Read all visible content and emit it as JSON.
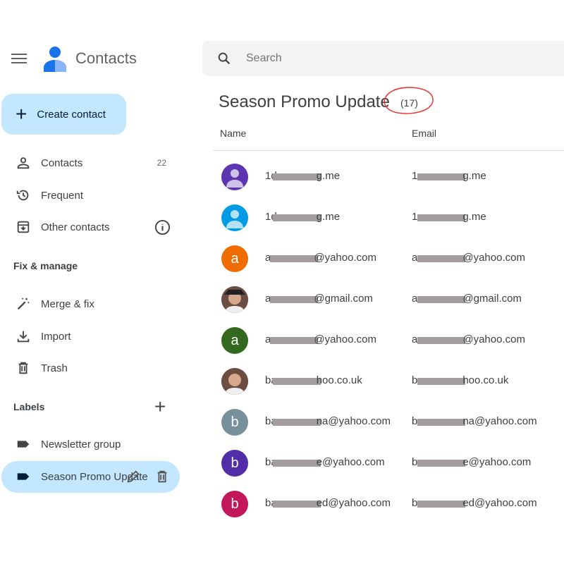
{
  "app": {
    "title": "Contacts"
  },
  "search": {
    "placeholder": "Search"
  },
  "sidebar": {
    "create_label": "Create contact",
    "items": [
      {
        "label": "Contacts",
        "count": "22"
      },
      {
        "label": "Frequent"
      },
      {
        "label": "Other contacts"
      }
    ],
    "fix_manage": {
      "heading": "Fix & manage",
      "items": [
        {
          "label": "Merge & fix"
        },
        {
          "label": "Import"
        },
        {
          "label": "Trash"
        }
      ]
    },
    "labels": {
      "heading": "Labels",
      "items": [
        {
          "label": "Newsletter group"
        },
        {
          "label": "Season Promo Update",
          "selected": true
        }
      ]
    }
  },
  "main": {
    "title": "Season Promo Update",
    "count": "(17)",
    "annotation_color": "#e53935",
    "columns": [
      "Name",
      "Email"
    ],
    "rows": [
      {
        "avatar": "person",
        "color": "#5e35b1",
        "name": [
          "1d",
          "g.me"
        ],
        "email": [
          "1",
          "g.me"
        ]
      },
      {
        "avatar": "person",
        "color": "#039be5",
        "name": [
          "1d",
          "g.me"
        ],
        "email": [
          "1",
          "g.me"
        ]
      },
      {
        "avatar": "a",
        "color": "#ef6c00",
        "name": [
          "ar",
          "@yahoo.com"
        ],
        "email": [
          "a",
          "@yahoo.com"
        ]
      },
      {
        "avatar": "photo",
        "color": "#8d6e63",
        "name": [
          "ar",
          "@gmail.com"
        ],
        "email": [
          "a",
          "@gmail.com"
        ]
      },
      {
        "avatar": "a",
        "color": "#33691e",
        "name": [
          "ar",
          "@yahoo.com"
        ],
        "email": [
          "a",
          "@yahoo.com"
        ]
      },
      {
        "avatar": "photo",
        "color": "#a1887f",
        "name": [
          "ba",
          "hoo.co.uk"
        ],
        "email": [
          "b",
          "hoo.co.uk"
        ]
      },
      {
        "avatar": "b",
        "color": "#78909c",
        "name": [
          "ba",
          "na@yahoo.com"
        ],
        "email": [
          "b",
          "na@yahoo.com"
        ]
      },
      {
        "avatar": "b",
        "color": "#512da8",
        "name": [
          "ba",
          "e@yahoo.com"
        ],
        "email": [
          "b",
          "e@yahoo.com"
        ]
      },
      {
        "avatar": "b",
        "color": "#c2185b",
        "name": [
          "ba",
          "ed@yahoo.com"
        ],
        "email": [
          "b",
          "ed@yahoo.com"
        ]
      }
    ]
  }
}
